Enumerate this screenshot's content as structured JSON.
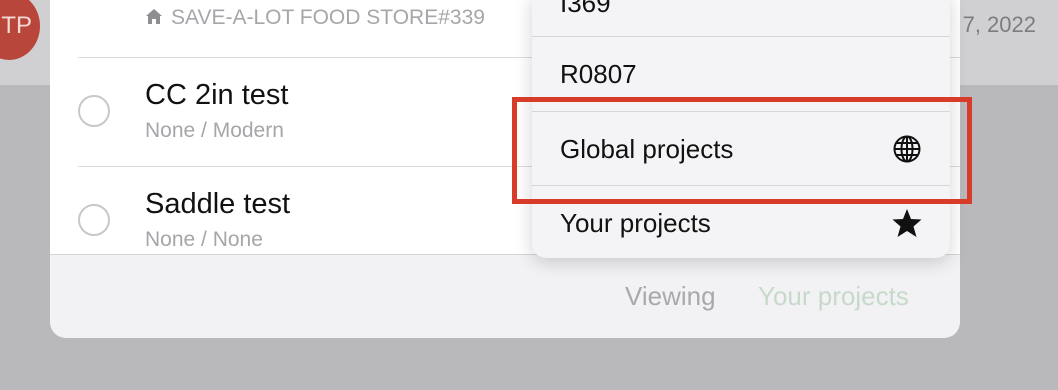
{
  "background": {
    "avatar_initials": "TP",
    "date_fragment": "7, 2022"
  },
  "projects": [
    {
      "title": "",
      "subtitle": "SAVE-A-LOT FOOD STORE#339"
    },
    {
      "title": "CC 2in test",
      "subtitle": "None / Modern"
    },
    {
      "title": "Saddle test",
      "subtitle": "None / None"
    }
  ],
  "footer": {
    "viewing_label": "Viewing",
    "current_filter": "Your projects"
  },
  "menu": {
    "items": [
      {
        "label": "I369",
        "icon": ""
      },
      {
        "label": "R0807",
        "icon": ""
      },
      {
        "label": "Global projects",
        "icon": "globe-icon"
      },
      {
        "label": "Your projects",
        "icon": "star-icon"
      }
    ]
  },
  "colors": {
    "highlight": "#d63c28",
    "accent_faded": "#c7d9c9",
    "avatar": "#b8463a"
  }
}
